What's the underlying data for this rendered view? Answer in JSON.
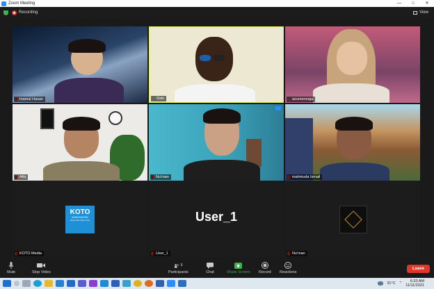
{
  "window": {
    "title": "Zoom Meeting"
  },
  "topbar": {
    "recording_label": "Recording",
    "view_label": "View"
  },
  "participants": [
    {
      "name": "Inamul Hasan"
    },
    {
      "name": "Oski"
    },
    {
      "name": "azureennaja"
    },
    {
      "name": "Afiq"
    },
    {
      "name": "Nu'man"
    },
    {
      "name": "mahmuda Ismail"
    },
    {
      "name": "KOTO Media",
      "logo_title": "KOTO",
      "logo_line1": "ASSOCIATION",
      "logo_line2": "Grow One Team One"
    },
    {
      "name": "User_1",
      "display_text": "User_1"
    },
    {
      "name": "Nu'man"
    }
  ],
  "toolbar": {
    "mute": "Mute",
    "stop_video": "Stop Video",
    "participants": "Participants",
    "participants_count": "9",
    "chat": "Chat",
    "share_screen": "Share Screen",
    "record": "Record",
    "reactions": "Reactions",
    "leave": "Leave"
  },
  "taskbar": {
    "temperature": "31°C",
    "time": "6:33 AM",
    "date": "11/11/2021"
  },
  "colors": {
    "accent": "#2d8cff",
    "leave": "#e0362c",
    "share": "#39b54a"
  }
}
